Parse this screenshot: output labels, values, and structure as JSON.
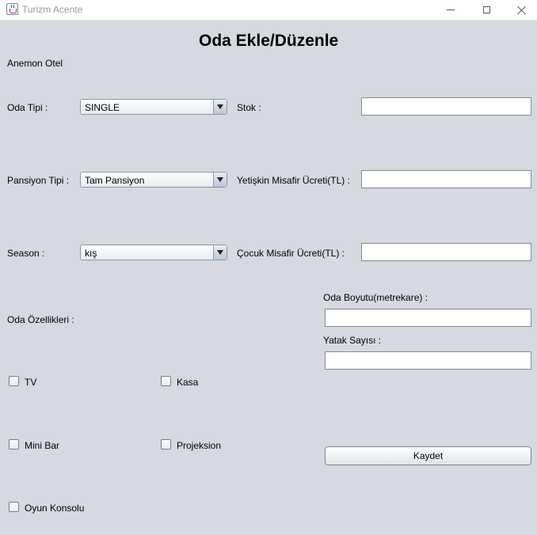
{
  "window": {
    "title": "Turizm Acente"
  },
  "heading": "Oda Ekle/Düzenle",
  "hotel_name": "Anemon Otel",
  "room_type": {
    "label": "Oda Tipi :",
    "value": "SINGLE"
  },
  "pension_type": {
    "label": "Pansiyon Tipi :",
    "value": "Tam Pansiyon"
  },
  "season": {
    "label": "Season :",
    "value": "kış"
  },
  "stock": {
    "label": "Stok :",
    "value": ""
  },
  "adult_price": {
    "label": "Yetişkin Misafir Ücreti(TL) :",
    "value": ""
  },
  "child_price": {
    "label": "Çocuk Misafir Ücreti(TL) :",
    "value": ""
  },
  "room_features_label": "Oda Özellikleri :",
  "room_size": {
    "label": "Oda Boyutu(metrekare) :",
    "value": ""
  },
  "bed_count": {
    "label": "Yatak Sayısı :",
    "value": ""
  },
  "features": {
    "tv": {
      "label": "TV",
      "checked": false
    },
    "safe": {
      "label": "Kasa",
      "checked": false
    },
    "minibar": {
      "label": "Mini Bar",
      "checked": false
    },
    "projection": {
      "label": "Projeksion",
      "checked": false
    },
    "console": {
      "label": "Oyun Konsolu",
      "checked": false
    }
  },
  "save_button": "Kaydet"
}
